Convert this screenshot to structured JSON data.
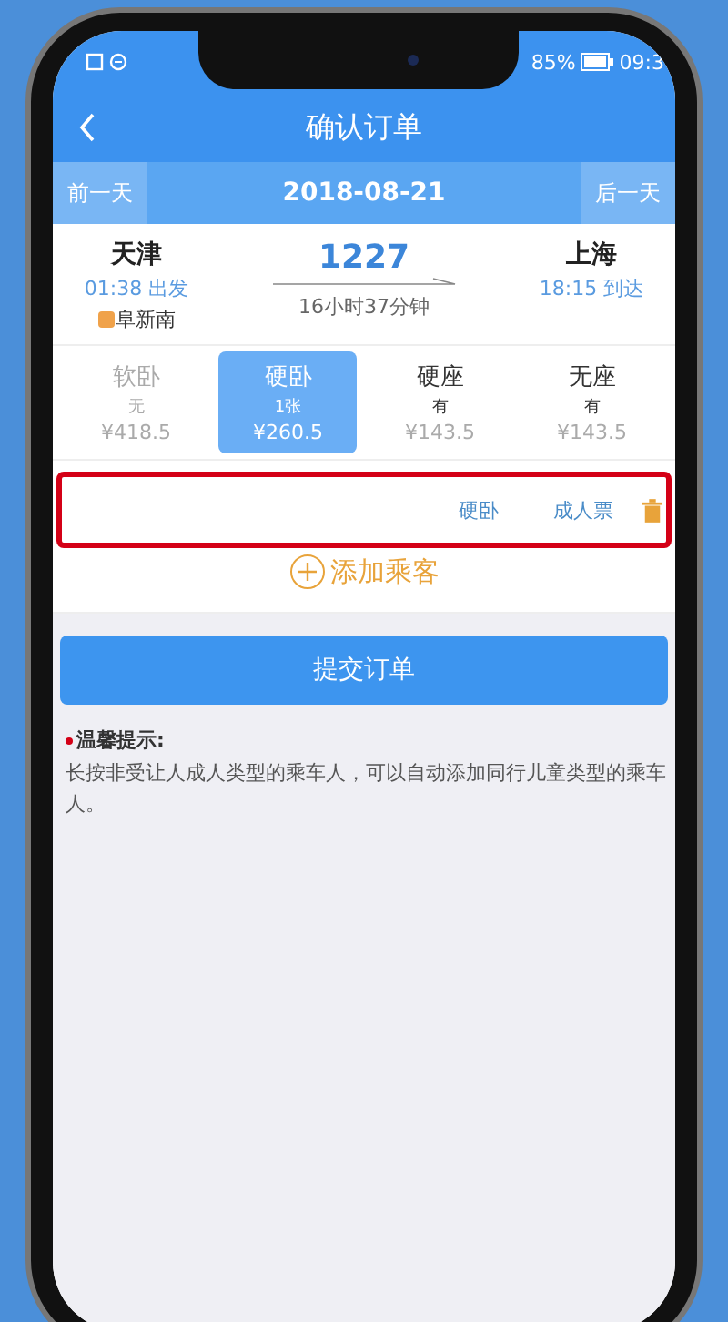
{
  "status_bar": {
    "battery": "85%",
    "time": "09:3"
  },
  "header": {
    "title": "确认订单"
  },
  "date_bar": {
    "prev": "前一天",
    "date": "2018-08-21",
    "next": "后一天"
  },
  "train": {
    "from": "天津",
    "depart": "01:38 出发",
    "station": "阜新南",
    "number": "1227",
    "duration": "16小时37分钟",
    "to": "上海",
    "arrive": "18:15 到达"
  },
  "seats": [
    {
      "name": "软卧",
      "availability": "无",
      "price": "¥418.5",
      "available": false,
      "selected": false
    },
    {
      "name": "硬卧",
      "availability": "1张",
      "price": "¥260.5",
      "available": true,
      "selected": true
    },
    {
      "name": "硬座",
      "availability": "有",
      "price": "¥143.5",
      "available": true,
      "selected": false
    },
    {
      "name": "无座",
      "availability": "有",
      "price": "¥143.5",
      "available": true,
      "selected": false
    }
  ],
  "passenger": {
    "seat": "硬卧",
    "ticket_type": "成人票",
    "highlighted": true
  },
  "add_passenger": "添加乘客",
  "submit": "提交订单",
  "tips": {
    "title": "温馨提示:",
    "text": "长按非受让人成人类型的乘车人，可以自动添加同行儿童类型的乘车人。"
  }
}
